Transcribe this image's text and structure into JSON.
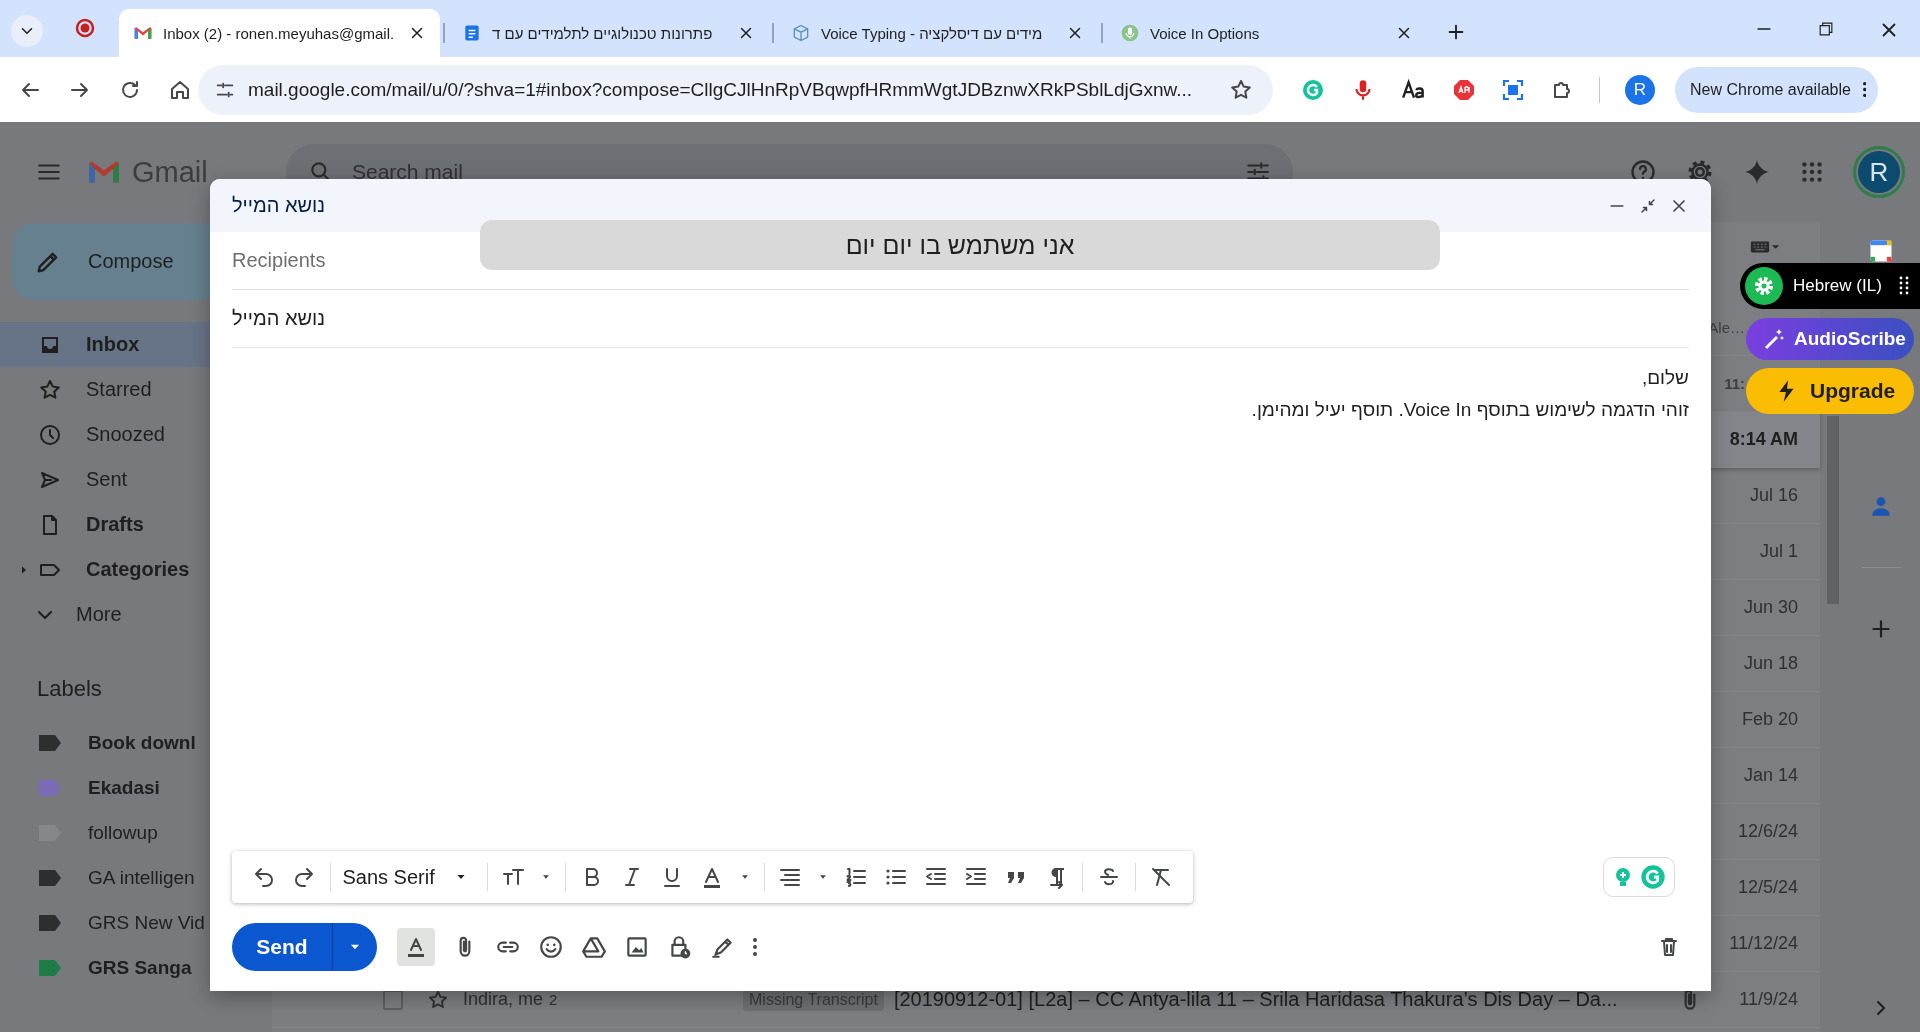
{
  "browser": {
    "tabs": [
      {
        "kind": "mail",
        "title": "Inbox (2) - ronen.meyuhas@gmail.",
        "selected": true
      },
      {
        "kind": "doc",
        "title": "פתרונות טכנולוגיים לתלמידים עם ד",
        "selected": false
      },
      {
        "kind": "site",
        "title": "Voice Typing - מידים עם דיסלקציה",
        "selected": false
      },
      {
        "kind": "extension",
        "title": "Voice In Options",
        "selected": false
      }
    ],
    "url": "mail.google.com/mail/u/0/?shva=1#inbox?compose=CllgCJlHnRpVBqwpfHRmmWgtJDBznwXRkPSblLdjGxnw...",
    "profile_initial": "R",
    "update_label": "New Chrome available"
  },
  "gmail": {
    "logo": "Gmail",
    "search_placeholder": "Search mail",
    "avatar_initial": "R",
    "compose_label": "Compose",
    "nav": [
      {
        "kind": "inbox",
        "label": "Inbox",
        "selected": true,
        "bold": true
      },
      {
        "kind": "starred",
        "label": "Starred",
        "selected": false,
        "bold": false
      },
      {
        "kind": "snoozed",
        "label": "Snoozed",
        "selected": false,
        "bold": false
      },
      {
        "kind": "sent",
        "label": "Sent",
        "selected": false,
        "bold": false
      },
      {
        "kind": "drafts",
        "label": "Drafts",
        "selected": false,
        "bold": true
      },
      {
        "kind": "categories",
        "label": "Categories",
        "selected": false,
        "bold": true,
        "expanded": false
      },
      {
        "kind": "more",
        "label": "More",
        "selected": false,
        "bold": false
      }
    ],
    "labels_heading": "Labels",
    "labels": [
      {
        "name": "Book downl",
        "bold": true,
        "color": "#2d2e30"
      },
      {
        "name": "Ekadasi",
        "bold": true,
        "color": "#7b6bb5"
      },
      {
        "name": "followup",
        "bold": false,
        "color": "#858789"
      },
      {
        "name": "GA intelligen",
        "bold": false,
        "color": "#2d2e30"
      },
      {
        "name": "GRS New Vid",
        "bold": false,
        "color": "#2d2e30"
      },
      {
        "name": "GRS Sanga",
        "bold": true,
        "color": "#1e7d46"
      }
    ],
    "messages": [
      {
        "kind": "partial",
        "date": "Ale…",
        "unread": false,
        "highlighted": false
      },
      {
        "kind": "partial",
        "date": "11:",
        "unread": true,
        "highlighted": false
      },
      {
        "date": "8:14 AM",
        "unread": true,
        "highlighted": true
      },
      {
        "date": "Jul 16",
        "unread": false,
        "highlighted": false
      },
      {
        "date": "Jul 1",
        "unread": false,
        "highlighted": false
      },
      {
        "date": "Jun 30",
        "unread": false,
        "highlighted": false
      },
      {
        "date": "Jun 18",
        "unread": false,
        "highlighted": false
      },
      {
        "date": "Feb 20",
        "unread": false,
        "highlighted": false
      },
      {
        "date": "Jan 14",
        "unread": false,
        "highlighted": false
      },
      {
        "date": "12/6/24",
        "unread": false,
        "highlighted": false
      },
      {
        "date": "12/5/24",
        "unread": false,
        "highlighted": false
      },
      {
        "date": "11/12/24",
        "unread": false,
        "highlighted": false
      },
      {
        "checked": false,
        "sender": "Indira, me",
        "count": "2",
        "label": "Missing Transcript",
        "subject": "[20190912-01] [L2a] – CC Antya-lila 11 – Srila Haridasa Thakura’s Dis Day – Da...",
        "has_attachment": true,
        "date": "11/9/24",
        "unread": false,
        "highlighted": false
      }
    ]
  },
  "compose": {
    "title": "נושא המייל",
    "recipients_placeholder": "Recipients",
    "subject": "נושא המייל",
    "body": [
      "שלום,",
      "זוהי הדגמה לשימוש בתוסף Voice In. תוסף יעיל ומהימן."
    ],
    "font": "Sans Serif",
    "send_label": "Send"
  },
  "voice_in": {
    "transcript": "אני משתמש בו יום יום",
    "language": "Hebrew (IL)"
  },
  "audioscribe": {
    "label": "AudioScribe",
    "upgrade_label": "Upgrade"
  }
}
